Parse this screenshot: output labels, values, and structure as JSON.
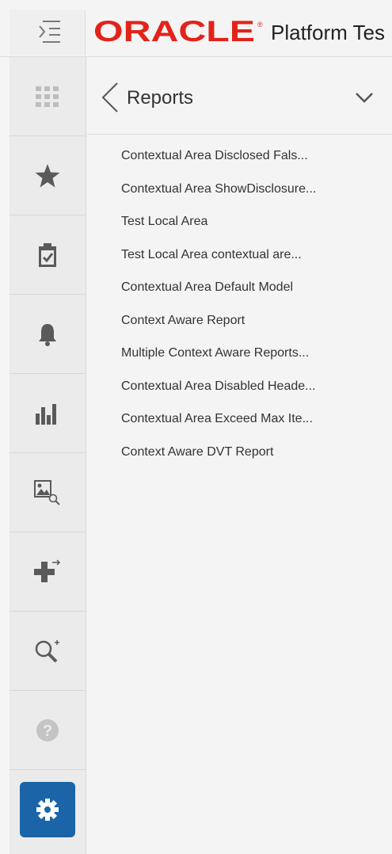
{
  "header": {
    "brand": "ORACLE",
    "title": "Platform Tes"
  },
  "rail": {
    "items": [
      {
        "icon": "apps-grid-icon"
      },
      {
        "icon": "star-icon"
      },
      {
        "icon": "clipboard-check-icon"
      },
      {
        "icon": "bell-icon"
      },
      {
        "icon": "bar-chart-icon"
      },
      {
        "icon": "image-search-icon"
      },
      {
        "icon": "add-transfer-icon"
      },
      {
        "icon": "search-add-icon"
      },
      {
        "icon": "help-icon"
      },
      {
        "icon": "gear-icon"
      }
    ]
  },
  "panel": {
    "title": "Reports",
    "reports": [
      "Contextual Area Disclosed Fals...",
      "Contextual Area ShowDisclosure...",
      "Test Local Area",
      "Test Local Area contextual are...",
      "Contextual Area Default Model",
      "Context Aware Report",
      "Multiple Context Aware Reports...",
      "Contextual Area Disabled Heade...",
      "Contextual Area Exceed Max Ite...",
      "Context Aware DVT Report"
    ]
  },
  "colors": {
    "brand_red": "#e2231a",
    "accent_blue": "#1b64a8",
    "icon_gray": "#5a5a5a"
  }
}
